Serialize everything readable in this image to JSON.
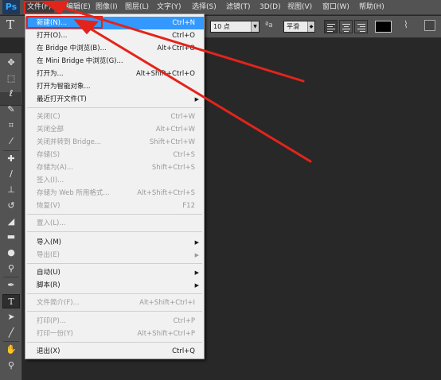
{
  "app": {
    "logo": "Ps"
  },
  "menubar": {
    "items": [
      {
        "label": "文件(F)"
      },
      {
        "label": "编辑(E)"
      },
      {
        "label": "图像(I)"
      },
      {
        "label": "图层(L)"
      },
      {
        "label": "文字(Y)"
      },
      {
        "label": "选择(S)"
      },
      {
        "label": "滤镜(T)"
      },
      {
        "label": "3D(D)"
      },
      {
        "label": "视图(V)"
      },
      {
        "label": "窗口(W)"
      },
      {
        "label": "帮助(H)"
      }
    ]
  },
  "options": {
    "tool_glyph": "T",
    "font_size": "10 点",
    "aa_icon": "ªa",
    "antialias": "平滑",
    "text_color": "#000000"
  },
  "file_menu": {
    "items": [
      {
        "label": "新建(N)...",
        "shortcut": "Ctrl+N",
        "state": "highlighted"
      },
      {
        "label": "打开(O)...",
        "shortcut": "Ctrl+O"
      },
      {
        "label": "在 Bridge 中浏览(B)...",
        "shortcut": "Alt+Ctrl+O"
      },
      {
        "label": "在 Mini Bridge 中浏览(G)...",
        "shortcut": ""
      },
      {
        "label": "打开为...",
        "shortcut": "Alt+Shift+Ctrl+O"
      },
      {
        "label": "打开为智能对象...",
        "shortcut": ""
      },
      {
        "label": "最近打开文件(T)",
        "shortcut": "",
        "submenu": true
      },
      {
        "label": "关闭(C)",
        "shortcut": "Ctrl+W",
        "state": "disabled"
      },
      {
        "label": "关闭全部",
        "shortcut": "Alt+Ctrl+W",
        "state": "disabled"
      },
      {
        "label": "关闭并转到 Bridge...",
        "shortcut": "Shift+Ctrl+W",
        "state": "disabled"
      },
      {
        "label": "存储(S)",
        "shortcut": "Ctrl+S",
        "state": "disabled"
      },
      {
        "label": "存储为(A)...",
        "shortcut": "Shift+Ctrl+S",
        "state": "disabled"
      },
      {
        "label": "签入(I)...",
        "shortcut": "",
        "state": "disabled"
      },
      {
        "label": "存储为 Web 所用格式...",
        "shortcut": "Alt+Shift+Ctrl+S",
        "state": "disabled"
      },
      {
        "label": "恢复(V)",
        "shortcut": "F12",
        "state": "disabled"
      },
      {
        "label": "置入(L)...",
        "shortcut": "",
        "state": "disabled"
      },
      {
        "label": "导入(M)",
        "shortcut": "",
        "submenu": true
      },
      {
        "label": "导出(E)",
        "shortcut": "",
        "submenu": true,
        "state": "disabled"
      },
      {
        "label": "自动(U)",
        "shortcut": "",
        "submenu": true
      },
      {
        "label": "脚本(R)",
        "shortcut": "",
        "submenu": true
      },
      {
        "label": "文件简介(F)...",
        "shortcut": "Alt+Shift+Ctrl+I",
        "state": "disabled"
      },
      {
        "label": "打印(P)...",
        "shortcut": "Ctrl+P",
        "state": "disabled"
      },
      {
        "label": "打印一份(Y)",
        "shortcut": "Alt+Shift+Ctrl+P",
        "state": "disabled"
      },
      {
        "label": "退出(X)",
        "shortcut": "Ctrl+Q"
      }
    ]
  },
  "annotation_color": "#e3241b",
  "highlight_color": "#3399ff"
}
